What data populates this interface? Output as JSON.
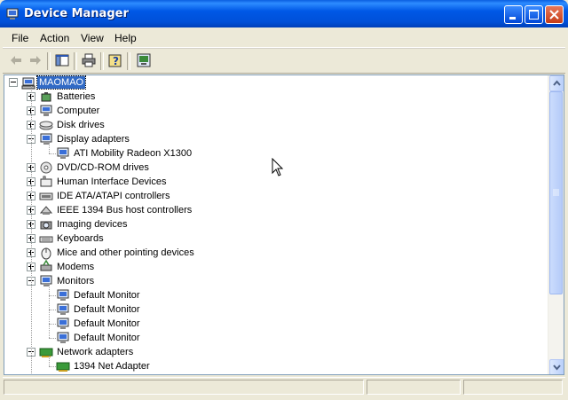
{
  "window": {
    "title": "Device Manager"
  },
  "menu": {
    "items": [
      "File",
      "Action",
      "View",
      "Help"
    ]
  },
  "toolbar": {
    "icons": [
      "back-arrow-icon",
      "forward-arrow-icon",
      "show-hide-console-tree-icon",
      "print-icon",
      "help-icon",
      "properties-icon"
    ]
  },
  "tree": {
    "root": "MAOMAO",
    "nodes": [
      {
        "label": "Batteries",
        "icon": "battery-icon",
        "expanded": false,
        "children": []
      },
      {
        "label": "Computer",
        "icon": "computer-icon",
        "expanded": false,
        "children": []
      },
      {
        "label": "Disk drives",
        "icon": "disk-drive-icon",
        "expanded": false,
        "children": []
      },
      {
        "label": "Display adapters",
        "icon": "display-adapter-icon",
        "expanded": true,
        "children": [
          "ATI Mobility Radeon X1300"
        ]
      },
      {
        "label": "DVD/CD-ROM drives",
        "icon": "cdrom-icon",
        "expanded": false,
        "children": []
      },
      {
        "label": "Human Interface Devices",
        "icon": "hid-icon",
        "expanded": false,
        "children": []
      },
      {
        "label": "IDE ATA/ATAPI controllers",
        "icon": "ide-controller-icon",
        "expanded": false,
        "children": []
      },
      {
        "label": "IEEE 1394 Bus host controllers",
        "icon": "ieee1394-icon",
        "expanded": false,
        "children": []
      },
      {
        "label": "Imaging devices",
        "icon": "camera-icon",
        "expanded": false,
        "children": []
      },
      {
        "label": "Keyboards",
        "icon": "keyboard-icon",
        "expanded": false,
        "children": []
      },
      {
        "label": "Mice and other pointing devices",
        "icon": "mouse-icon",
        "expanded": false,
        "children": []
      },
      {
        "label": "Modems",
        "icon": "modem-icon",
        "expanded": false,
        "children": []
      },
      {
        "label": "Monitors",
        "icon": "monitor-icon",
        "expanded": true,
        "children": [
          "Default Monitor",
          "Default Monitor",
          "Default Monitor",
          "Default Monitor"
        ]
      },
      {
        "label": "Network adapters",
        "icon": "network-adapter-icon",
        "expanded": true,
        "children": [
          "1394 Net Adapter"
        ]
      }
    ]
  },
  "colors": {
    "titlebar": "#0058e6",
    "selection": "#316ac5",
    "window_bg": "#ece9d8"
  }
}
